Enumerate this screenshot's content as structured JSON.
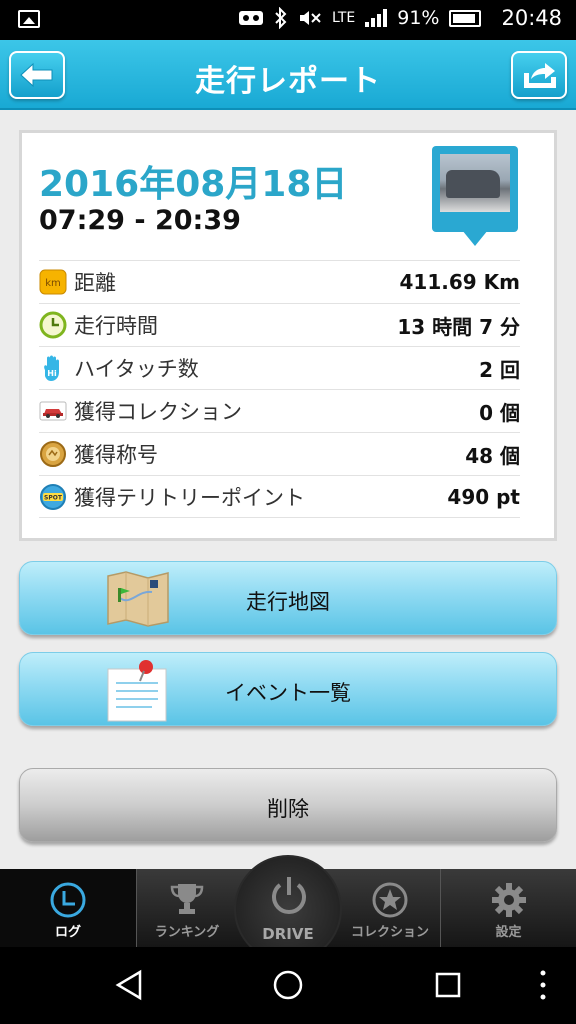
{
  "status_bar": {
    "lte": "LTE",
    "battery_percent": "91%",
    "clock": "20:48",
    "icons": [
      "image-icon",
      "vr-icon",
      "bluetooth-icon",
      "mute-icon",
      "signal-icon",
      "battery-icon"
    ]
  },
  "header": {
    "title": "走行レポート",
    "back_icon": "back-arrow-icon",
    "share_icon": "share-icon"
  },
  "report": {
    "date": "2016年08月18日",
    "time_range": "07:29 - 20:39",
    "rows": [
      {
        "icon": "km-icon",
        "icon_text": "km",
        "label": "距離",
        "value": "411.69 Km"
      },
      {
        "icon": "clock-icon",
        "label": "走行時間",
        "value": "13 時間 7 分"
      },
      {
        "icon": "hi-touch-icon",
        "icon_text": "Hi",
        "label": "ハイタッチ数",
        "value": "2 回"
      },
      {
        "icon": "car-collection-icon",
        "label": "獲得コレクション",
        "value": "0 個"
      },
      {
        "icon": "title-medal-icon",
        "label": "獲得称号",
        "value": "48 個"
      },
      {
        "icon": "spot-icon",
        "icon_text": "SPOT",
        "label": "獲得テリトリーポイント",
        "value": "490 pt"
      }
    ]
  },
  "buttons": {
    "map_label": "走行地図",
    "event_label": "イベント一覧",
    "delete_label": "削除"
  },
  "tabs": [
    {
      "label": "ログ",
      "icon": "log-clock-icon",
      "active": true
    },
    {
      "label": "ランキング",
      "icon": "trophy-icon",
      "active": false
    },
    {
      "label": "DRIVE",
      "icon": "power-icon",
      "active": false
    },
    {
      "label": "コレクション",
      "icon": "star-icon",
      "active": false
    },
    {
      "label": "設定",
      "icon": "gear-icon",
      "active": false
    }
  ],
  "colors": {
    "header": "#19a9d4",
    "date_text": "#2ba6c9",
    "button_blue": "#8fdaf2",
    "tab_active": "#3aa9e0"
  }
}
